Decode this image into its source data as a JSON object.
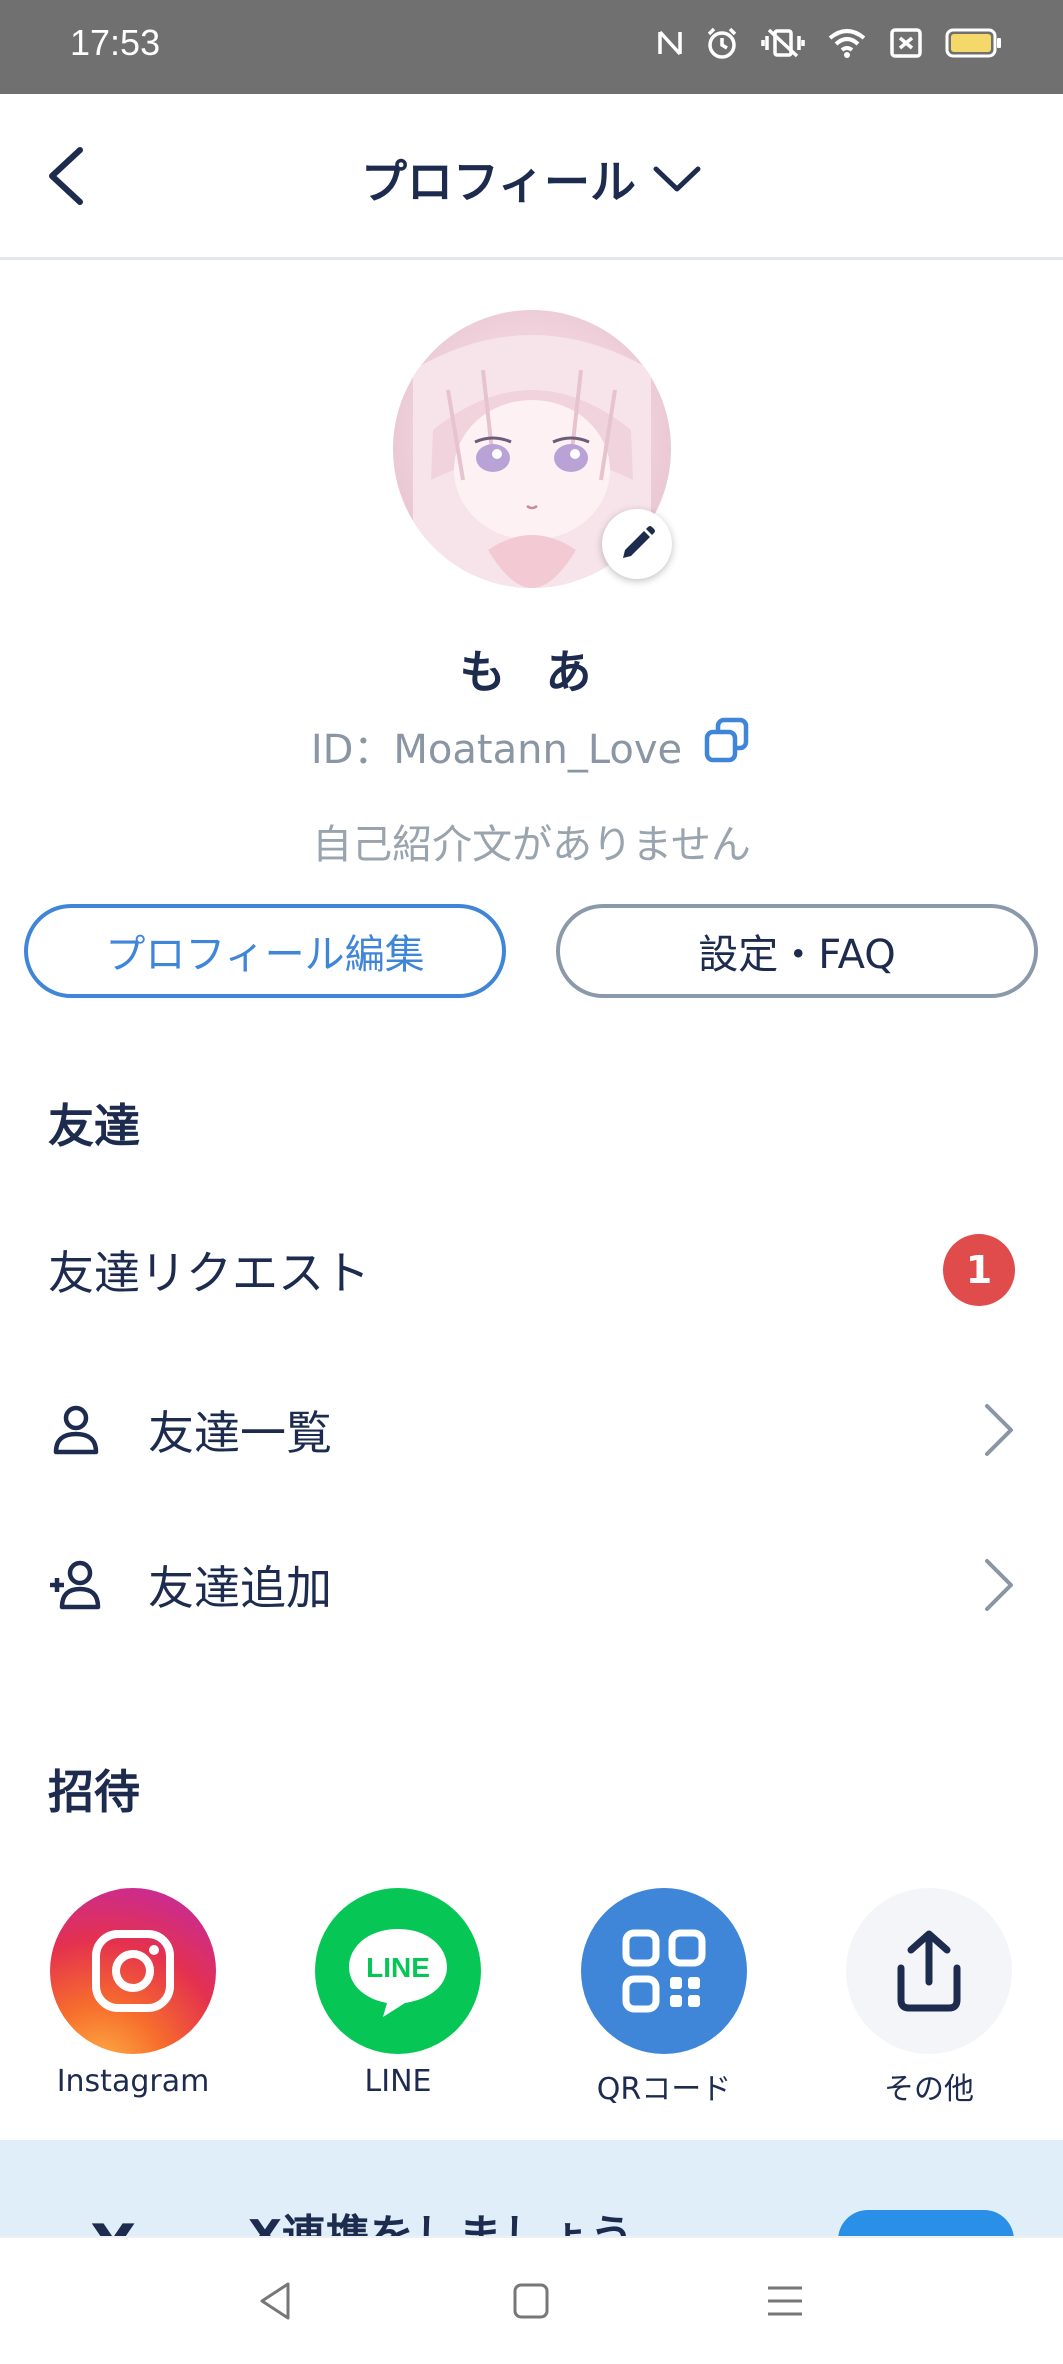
{
  "status_bar": {
    "time": "17:53",
    "icons": [
      "nfc-icon",
      "alarm-icon",
      "vibrate-off-icon",
      "wifi-icon",
      "battery-saver-icon",
      "battery-icon"
    ]
  },
  "header": {
    "title": "プロフィール",
    "back_icon": "chevron-left-icon",
    "dropdown_icon": "chevron-down-icon"
  },
  "profile": {
    "name": "も あ",
    "id_text": "ID：Moatann_Love",
    "bio": "自己紹介文がありません"
  },
  "buttons": {
    "edit_label": "プロフィール編集",
    "settings_label": "設定・FAQ"
  },
  "friends": {
    "section_title": "友達",
    "request_label": "友達リクエスト",
    "request_count": "1",
    "list_label": "友達一覧",
    "add_label": "友達追加"
  },
  "invite": {
    "section_title": "招待",
    "items": [
      {
        "label": "Instagram",
        "icon": "instagram-icon"
      },
      {
        "label": "LINE",
        "icon": "line-icon"
      },
      {
        "label": "QRコード",
        "icon": "qr-code-icon"
      },
      {
        "label": "その他",
        "icon": "share-icon"
      }
    ],
    "line_logo_text": "LINE"
  },
  "banner": {
    "text": "X連携をしましょう",
    "logo": "X"
  },
  "colors": {
    "accent": "#3f86d9",
    "text_primary": "#1d2b4f",
    "badge_red": "#e04b4b",
    "banner_bg": "#dfeef8"
  }
}
